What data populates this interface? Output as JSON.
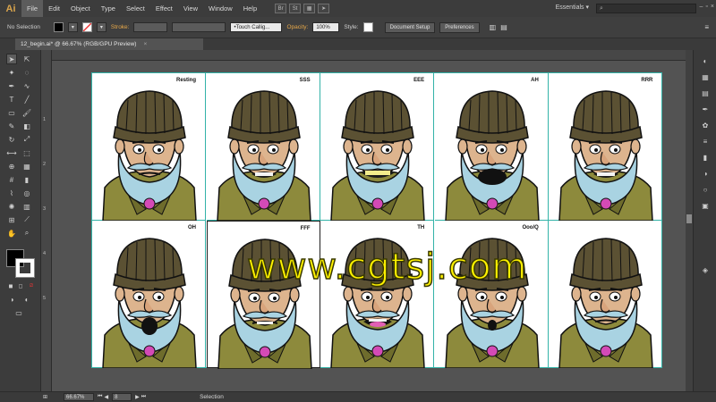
{
  "app": {
    "logo": "Ai"
  },
  "menus": [
    "File",
    "Edit",
    "Object",
    "Type",
    "Select",
    "Effect",
    "View",
    "Window",
    "Help"
  ],
  "menubar_icons": [
    "Br",
    "St"
  ],
  "workspace": "Essentials",
  "control": {
    "selection": "No Selection",
    "stroke_label": "Stroke:",
    "brush": "Touch Callig...",
    "opacity_label": "Opacity:",
    "opacity_value": "100%",
    "style_label": "Style:",
    "doc_setup": "Document Setup",
    "preferences": "Preferences",
    "fill_color": "#000000",
    "accent": "#e7a849"
  },
  "document_tab": {
    "title": "12_begin.ai* @ 66.67% (RGB/GPU Preview)",
    "close": "×"
  },
  "ruler_v_ticks": [
    "1",
    "2",
    "3",
    "4",
    "5"
  ],
  "artboards": [
    {
      "label": "Resting",
      "mouth": "closed"
    },
    {
      "label": "SSS",
      "mouth": "teeth"
    },
    {
      "label": "EEE",
      "mouth": "wide-teeth"
    },
    {
      "label": "AH",
      "mouth": "open"
    },
    {
      "label": "RRR",
      "mouth": "teeth"
    },
    {
      "label": "OH",
      "mouth": "round"
    },
    {
      "label": "FFF",
      "mouth": "lip"
    },
    {
      "label": "TH",
      "mouth": "tongue"
    },
    {
      "label": "Ooo/Q",
      "mouth": "small-round"
    },
    {
      "label": "",
      "mouth": "closed"
    }
  ],
  "watermark": "www.cgtsj.com",
  "status": {
    "zoom": "66.67%",
    "page": "8",
    "tool": "Selection"
  }
}
